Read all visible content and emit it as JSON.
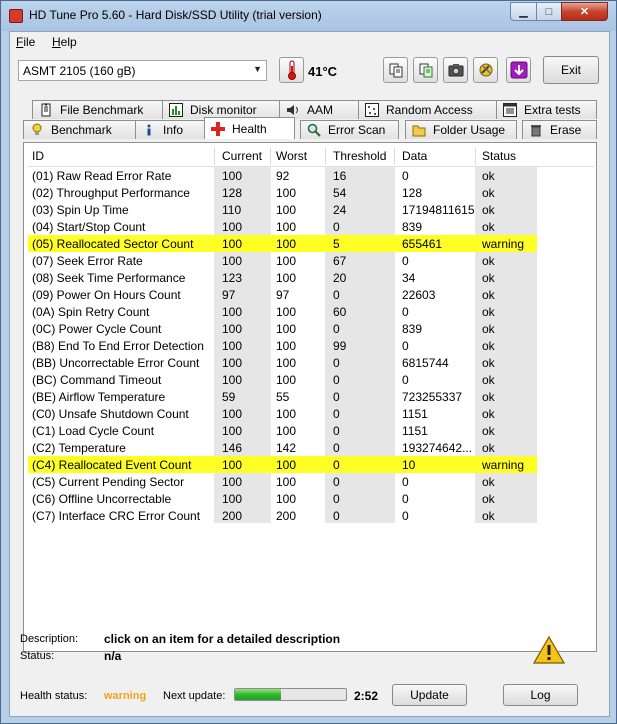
{
  "window": {
    "title": "HD Tune Pro 5.60 - Hard Disk/SSD Utility (trial version)",
    "min_glyph": "▁",
    "max_glyph": "□",
    "close_glyph": "✕"
  },
  "menu": {
    "file_rest": "ile",
    "file_key": "F",
    "help_rest": "elp",
    "help_key": "H"
  },
  "toolbar": {
    "drive": "ASMT    2105 (160 gB)",
    "temperature": "41°C",
    "exit_label": "Exit"
  },
  "tabs": {
    "row1": [
      "File Benchmark",
      "Disk monitor",
      "AAM",
      "Random Access",
      "Extra tests"
    ],
    "row2": [
      "Benchmark",
      "Info",
      "Health",
      "Error Scan",
      "Folder Usage",
      "Erase"
    ],
    "active": "Health"
  },
  "table": {
    "headers": [
      "ID",
      "Current",
      "Worst",
      "Threshold",
      "Data",
      "Status"
    ],
    "rows": [
      [
        "(01) Raw Read Error Rate",
        "100",
        "92",
        "16",
        "0",
        "ok"
      ],
      [
        "(02) Throughput Performance",
        "128",
        "100",
        "54",
        "128",
        "ok"
      ],
      [
        "(03) Spin Up Time",
        "110",
        "100",
        "24",
        "17194811615",
        "ok"
      ],
      [
        "(04) Start/Stop Count",
        "100",
        "100",
        "0",
        "839",
        "ok"
      ],
      [
        "(05) Reallocated Sector Count",
        "100",
        "100",
        "5",
        "655461",
        "warning"
      ],
      [
        "(07) Seek Error Rate",
        "100",
        "100",
        "67",
        "0",
        "ok"
      ],
      [
        "(08) Seek Time Performance",
        "123",
        "100",
        "20",
        "34",
        "ok"
      ],
      [
        "(09) Power On Hours Count",
        "97",
        "97",
        "0",
        "22603",
        "ok"
      ],
      [
        "(0A) Spin Retry Count",
        "100",
        "100",
        "60",
        "0",
        "ok"
      ],
      [
        "(0C) Power Cycle Count",
        "100",
        "100",
        "0",
        "839",
        "ok"
      ],
      [
        "(B8) End To End Error Detection",
        "100",
        "100",
        "99",
        "0",
        "ok"
      ],
      [
        "(BB) Uncorrectable Error Count",
        "100",
        "100",
        "0",
        "6815744",
        "ok"
      ],
      [
        "(BC) Command Timeout",
        "100",
        "100",
        "0",
        "0",
        "ok"
      ],
      [
        "(BE) Airflow Temperature",
        "59",
        "55",
        "0",
        "723255337",
        "ok"
      ],
      [
        "(C0) Unsafe Shutdown Count",
        "100",
        "100",
        "0",
        "1151",
        "ok"
      ],
      [
        "(C1) Load Cycle Count",
        "100",
        "100",
        "0",
        "1151",
        "ok"
      ],
      [
        "(C2) Temperature",
        "146",
        "142",
        "0",
        "193274642...",
        "ok"
      ],
      [
        "(C4) Reallocated Event Count",
        "100",
        "100",
        "0",
        "10",
        "warning"
      ],
      [
        "(C5) Current Pending Sector",
        "100",
        "100",
        "0",
        "0",
        "ok"
      ],
      [
        "(C6) Offline Uncorrectable",
        "100",
        "100",
        "0",
        "0",
        "ok"
      ],
      [
        "(C7) Interface CRC Error Count",
        "200",
        "200",
        "0",
        "0",
        "ok"
      ]
    ]
  },
  "details": {
    "description_label": "Description:",
    "description_value": "click on an item for a detailed description",
    "status_label": "Status:",
    "status_value": "n/a"
  },
  "status_bar": {
    "health_label": "Health status:",
    "health_value": "warning",
    "next_update_label": "Next update:",
    "progress_fraction": 0.41,
    "countdown": "2:52",
    "update_label": "Update",
    "log_label": "Log"
  },
  "colors": {
    "warning_highlight": "#ffff26",
    "health_warning_text": "#f2a31a",
    "progress_green": "#2eb82e"
  }
}
